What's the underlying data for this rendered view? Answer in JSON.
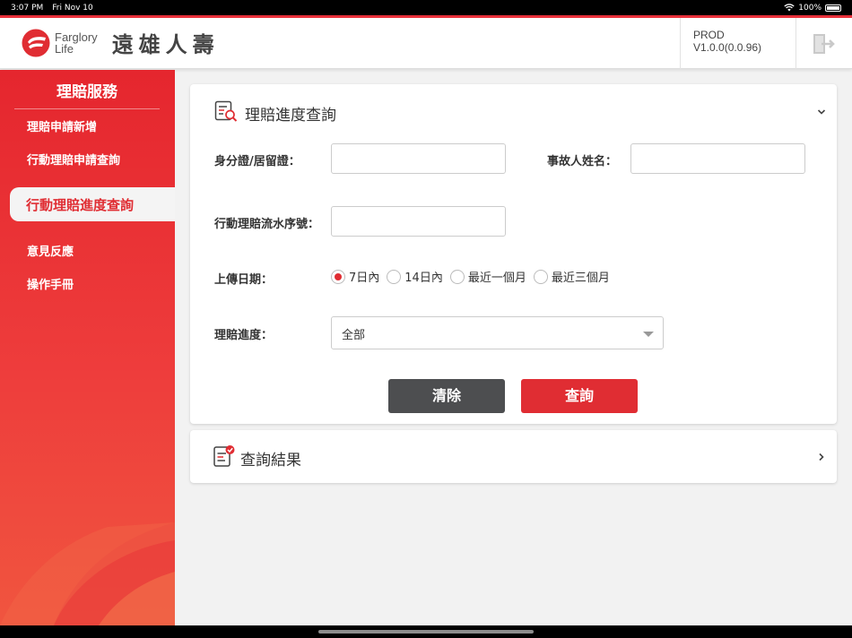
{
  "status_bar": {
    "time": "3:07 PM",
    "date": "Fri Nov 10",
    "battery": "100%"
  },
  "header": {
    "logo_en_line1": "Farglory",
    "logo_en_line2": "Life",
    "logo_zh": "遠雄人壽",
    "version": "PROD V1.0.0(0.0.96)"
  },
  "sidebar": {
    "title": "理賠服務",
    "items": [
      {
        "label": "理賠申請新增"
      },
      {
        "label": "行動理賠申請查詢"
      },
      {
        "label": "行動理賠進度查詢"
      },
      {
        "label": "意見反應"
      },
      {
        "label": "操作手冊"
      }
    ]
  },
  "query_card": {
    "title": "理賠進度查詢",
    "id_label": "身分證/居留證：",
    "id_value": "",
    "name_label": "事故人姓名：",
    "name_value": "",
    "serial_label": "行動理賠流水序號：",
    "serial_value": "",
    "upload_date_label": "上傳日期：",
    "upload_options": [
      {
        "label": "7日內",
        "selected": true
      },
      {
        "label": "14日內",
        "selected": false
      },
      {
        "label": "最近一個月",
        "selected": false
      },
      {
        "label": "最近三個月",
        "selected": false
      }
    ],
    "progress_label": "理賠進度：",
    "progress_selected": "全部",
    "clear_button": "清除",
    "query_button": "查詢"
  },
  "results_card": {
    "title": "查詢結果"
  },
  "colors": {
    "accent": "#e02d33",
    "dark_button": "#4d4e50"
  }
}
